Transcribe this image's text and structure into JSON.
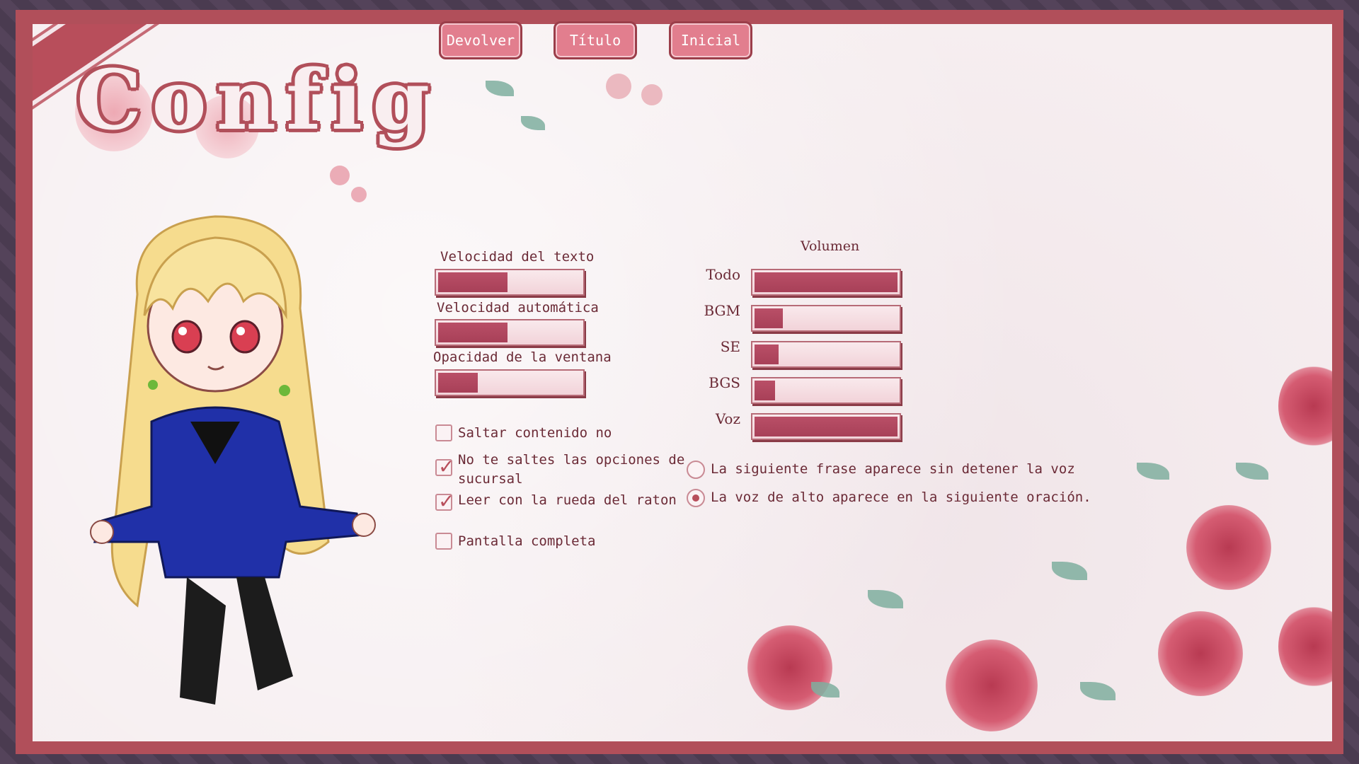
{
  "title": "Config",
  "nav": {
    "return_label": "Devolver",
    "title_label": "Título",
    "home_label": "Inicial"
  },
  "text_settings": {
    "text_speed_label": "Velocidad del texto",
    "text_speed_value": 0.5,
    "auto_speed_label": "Velocidad automática",
    "auto_speed_value": 0.5,
    "window_opacity_label": "Opacidad de la ventana",
    "window_opacity_value": 0.3
  },
  "volume": {
    "heading": "Volumen",
    "channels": [
      {
        "label": "Todo",
        "value": 1.0
      },
      {
        "label": "BGM",
        "value": 0.22
      },
      {
        "label": "SE",
        "value": 0.19
      },
      {
        "label": "BGS",
        "value": 0.17
      },
      {
        "label": "Voz",
        "value": 1.0
      }
    ]
  },
  "options": {
    "skip_unread_label": "Saltar contenido no",
    "skip_unread_checked": false,
    "no_skip_branch_label_1": "No te saltes las opciones de",
    "no_skip_branch_label_2": "sucursal",
    "no_skip_branch_checked": true,
    "wheel_read_label": "Leer con la rueda del raton",
    "wheel_read_checked": true,
    "fullscreen_label": "Pantalla completa",
    "fullscreen_checked": false
  },
  "voice_mode": {
    "option_1": "La siguiente frase aparece sin detener la voz",
    "option_2": "La voz de alto aparece en la siguiente oración.",
    "selected": 2
  },
  "colors": {
    "frame": "#b14f5a",
    "accent": "#b84e5b",
    "button": "#e27e8e"
  }
}
